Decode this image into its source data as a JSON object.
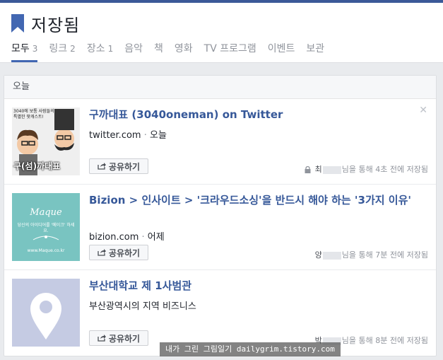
{
  "header": {
    "title": "저장됨",
    "tabs": [
      {
        "label": "모두",
        "count": "3"
      },
      {
        "label": "링크",
        "count": "2"
      },
      {
        "label": "장소",
        "count": "1"
      },
      {
        "label": "음악",
        "count": ""
      },
      {
        "label": "책",
        "count": ""
      },
      {
        "label": "영화",
        "count": ""
      },
      {
        "label": "TV 프로그램",
        "count": ""
      },
      {
        "label": "이벤트",
        "count": ""
      },
      {
        "label": "보관",
        "count": ""
      }
    ]
  },
  "section": {
    "title": "오늘"
  },
  "items": [
    {
      "title": "구까대표 (3040oneman) on Twitter",
      "source": "twitter.com",
      "time": "오늘",
      "share": "공유하기",
      "via_name": "최",
      "via_mid": "님을 통해",
      "via_time": "4초 전에 저장됨",
      "thumb_text_top": "3040에 보통 사람들의 특별한 팟캐스트!",
      "thumb_text_bottom": "구(섬)까대표"
    },
    {
      "title": "Bizion > 인사이트 > '크라우드소싱'을 반드시 해야 하는 '3가지 이유'",
      "source": "bizion.com",
      "time": "어제",
      "share": "공유하기",
      "via_name": "양",
      "via_mid": "님을 통해",
      "via_time": "7분 전에 저장됨",
      "thumb_brand": "Maque",
      "thumb_line": "당신의 아이디어를 '메이크' 하세요.",
      "thumb_url": "www.Maque.co.kr"
    },
    {
      "title": "부산대학교 제 1사범관",
      "sub": "부산광역시의 지역 비즈니스",
      "share": "공유하기",
      "via_name": "박",
      "via_mid": "님을 통해",
      "via_time": "8분 전에 저장됨"
    }
  ],
  "watermark": "내가 그린 그림일기 dailygrim.tistory.com",
  "colors": {
    "accent": "#3b5998",
    "link": "#365899",
    "tab_underline": "#4267b2",
    "place_thumb": "#c5cbe3"
  }
}
